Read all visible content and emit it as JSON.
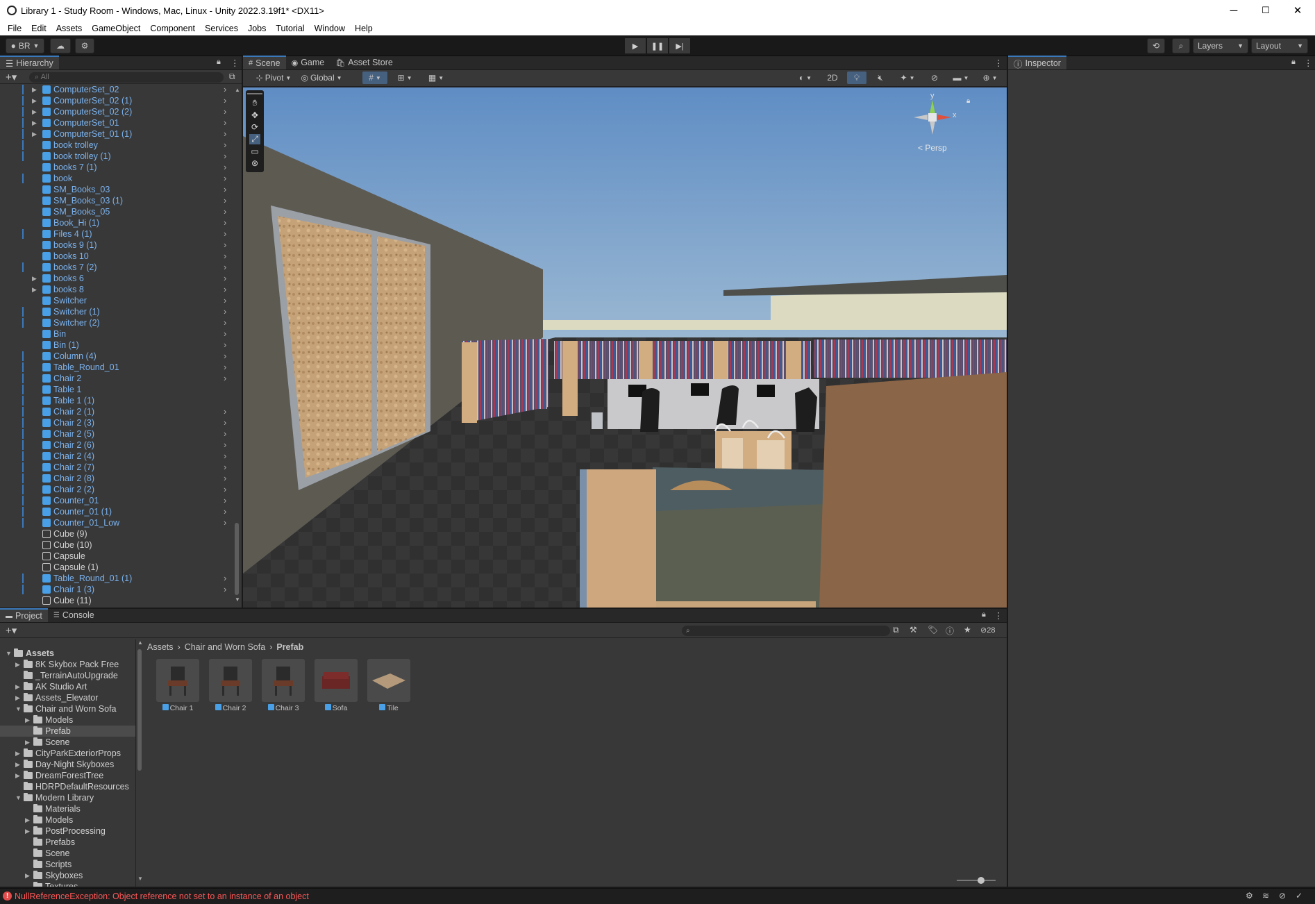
{
  "window": {
    "title": "Library 1 - Study Room - Windows, Mac, Linux - Unity 2022.3.19f1* <DX11>",
    "minimize": "─",
    "maximize": "☐",
    "close": "✕"
  },
  "menu": [
    "File",
    "Edit",
    "Assets",
    "GameObject",
    "Component",
    "Services",
    "Jobs",
    "Tutorial",
    "Window",
    "Help"
  ],
  "toolbar": {
    "account": "BR",
    "layers": "Layers",
    "layout": "Layout"
  },
  "hierarchy": {
    "tab": "Hierarchy",
    "search_placeholder": "All",
    "items": [
      {
        "name": "ComputerSet_02",
        "fold": true,
        "bar": true,
        "arrow": true,
        "prefab": true
      },
      {
        "name": "ComputerSet_02 (1)",
        "fold": true,
        "bar": true,
        "arrow": true,
        "prefab": true
      },
      {
        "name": "ComputerSet_02 (2)",
        "fold": true,
        "bar": true,
        "arrow": true,
        "prefab": true
      },
      {
        "name": "ComputerSet_01",
        "fold": true,
        "bar": true,
        "arrow": true,
        "prefab": true
      },
      {
        "name": "ComputerSet_01 (1)",
        "fold": true,
        "bar": true,
        "arrow": true,
        "prefab": true
      },
      {
        "name": "book trolley",
        "fold": false,
        "bar": true,
        "arrow": true,
        "prefab": true
      },
      {
        "name": "book trolley (1)",
        "fold": false,
        "bar": true,
        "arrow": true,
        "prefab": true
      },
      {
        "name": "books 7 (1)",
        "fold": false,
        "bar": false,
        "arrow": true,
        "prefab": true
      },
      {
        "name": "book",
        "fold": false,
        "bar": true,
        "arrow": true,
        "prefab": true
      },
      {
        "name": "SM_Books_03",
        "fold": false,
        "bar": false,
        "arrow": true,
        "prefab": true
      },
      {
        "name": "SM_Books_03 (1)",
        "fold": false,
        "bar": false,
        "arrow": true,
        "prefab": true
      },
      {
        "name": "SM_Books_05",
        "fold": false,
        "bar": false,
        "arrow": true,
        "prefab": true
      },
      {
        "name": "Book_Hi (1)",
        "fold": false,
        "bar": false,
        "arrow": true,
        "prefab": true
      },
      {
        "name": "Files 4 (1)",
        "fold": false,
        "bar": true,
        "arrow": true,
        "prefab": true
      },
      {
        "name": "books 9 (1)",
        "fold": false,
        "bar": false,
        "arrow": true,
        "prefab": true
      },
      {
        "name": "books 10",
        "fold": false,
        "bar": false,
        "arrow": true,
        "prefab": true
      },
      {
        "name": "books 7 (2)",
        "fold": false,
        "bar": true,
        "arrow": true,
        "prefab": true
      },
      {
        "name": "books 6",
        "fold": true,
        "bar": false,
        "arrow": true,
        "prefab": true
      },
      {
        "name": "books 8",
        "fold": true,
        "bar": false,
        "arrow": true,
        "prefab": true
      },
      {
        "name": "Switcher",
        "fold": false,
        "bar": false,
        "arrow": true,
        "prefab": true
      },
      {
        "name": "Switcher (1)",
        "fold": false,
        "bar": true,
        "arrow": true,
        "prefab": true
      },
      {
        "name": "Switcher (2)",
        "fold": false,
        "bar": true,
        "arrow": true,
        "prefab": true
      },
      {
        "name": "Bin",
        "fold": false,
        "bar": false,
        "arrow": true,
        "prefab": true
      },
      {
        "name": "Bin (1)",
        "fold": false,
        "bar": false,
        "arrow": true,
        "prefab": true
      },
      {
        "name": "Column (4)",
        "fold": false,
        "bar": true,
        "arrow": true,
        "prefab": true
      },
      {
        "name": "Table_Round_01",
        "fold": false,
        "bar": true,
        "arrow": true,
        "prefab": true
      },
      {
        "name": "Chair 2",
        "fold": false,
        "bar": true,
        "arrow": true,
        "prefab": true
      },
      {
        "name": "Table 1",
        "fold": false,
        "bar": true,
        "arrow": false,
        "prefab": true
      },
      {
        "name": "Table 1 (1)",
        "fold": false,
        "bar": true,
        "arrow": false,
        "prefab": true
      },
      {
        "name": "Chair 2 (1)",
        "fold": false,
        "bar": true,
        "arrow": true,
        "prefab": true
      },
      {
        "name": "Chair 2 (3)",
        "fold": false,
        "bar": true,
        "arrow": true,
        "prefab": true
      },
      {
        "name": "Chair 2 (5)",
        "fold": false,
        "bar": true,
        "arrow": true,
        "prefab": true
      },
      {
        "name": "Chair 2 (6)",
        "fold": false,
        "bar": true,
        "arrow": true,
        "prefab": true
      },
      {
        "name": "Chair 2 (4)",
        "fold": false,
        "bar": true,
        "arrow": true,
        "prefab": true
      },
      {
        "name": "Chair 2 (7)",
        "fold": false,
        "bar": true,
        "arrow": true,
        "prefab": true
      },
      {
        "name": "Chair 2 (8)",
        "fold": false,
        "bar": true,
        "arrow": true,
        "prefab": true
      },
      {
        "name": "Chair 2 (2)",
        "fold": false,
        "bar": true,
        "arrow": true,
        "prefab": true
      },
      {
        "name": "Counter_01",
        "fold": false,
        "bar": true,
        "arrow": true,
        "prefab": true
      },
      {
        "name": "Counter_01 (1)",
        "fold": false,
        "bar": true,
        "arrow": true,
        "prefab": true
      },
      {
        "name": "Counter_01_Low",
        "fold": false,
        "bar": true,
        "arrow": true,
        "prefab": true
      },
      {
        "name": "Cube (9)",
        "fold": false,
        "bar": false,
        "arrow": false,
        "prefab": false
      },
      {
        "name": "Cube (10)",
        "fold": false,
        "bar": false,
        "arrow": false,
        "prefab": false
      },
      {
        "name": "Capsule",
        "fold": false,
        "bar": false,
        "arrow": false,
        "prefab": false
      },
      {
        "name": "Capsule (1)",
        "fold": false,
        "bar": false,
        "arrow": false,
        "prefab": false
      },
      {
        "name": "Table_Round_01 (1)",
        "fold": false,
        "bar": true,
        "arrow": true,
        "prefab": true
      },
      {
        "name": "Chair 1 (3)",
        "fold": false,
        "bar": true,
        "arrow": true,
        "prefab": true
      },
      {
        "name": "Cube (11)",
        "fold": false,
        "bar": false,
        "arrow": false,
        "prefab": false
      }
    ]
  },
  "scene": {
    "tabs": [
      "Scene",
      "Game",
      "Asset Store"
    ],
    "pivot": "Pivot",
    "global": "Global",
    "mode_2d": "2D",
    "persp": "< Persp",
    "gizmo_y": "y",
    "gizmo_x": "x"
  },
  "inspector": {
    "tab": "Inspector"
  },
  "project": {
    "tabs": [
      "Project",
      "Console"
    ],
    "hidden_count": "28",
    "breadcrumb": [
      "Assets",
      "Chair and Worn Sofa",
      "Prefab"
    ],
    "tree": [
      {
        "name": "Assets",
        "depth": 0,
        "expanded": true,
        "bold": true
      },
      {
        "name": "8K Skybox Pack Free",
        "depth": 1,
        "expanded": false
      },
      {
        "name": "_TerrainAutoUpgrade",
        "depth": 1,
        "expanded": null
      },
      {
        "name": "AK Studio Art",
        "depth": 1,
        "expanded": false
      },
      {
        "name": "Assets_Elevator",
        "depth": 1,
        "expanded": false
      },
      {
        "name": "Chair and Worn Sofa",
        "depth": 1,
        "expanded": true
      },
      {
        "name": "Models",
        "depth": 2,
        "expanded": false
      },
      {
        "name": "Prefab",
        "depth": 2,
        "expanded": null,
        "selected": true
      },
      {
        "name": "Scene",
        "depth": 2,
        "expanded": false
      },
      {
        "name": "CityParkExteriorProps",
        "depth": 1,
        "expanded": false
      },
      {
        "name": "Day-Night Skyboxes",
        "depth": 1,
        "expanded": false
      },
      {
        "name": "DreamForestTree",
        "depth": 1,
        "expanded": false
      },
      {
        "name": "HDRPDefaultResources",
        "depth": 1,
        "expanded": null
      },
      {
        "name": "Modern Library",
        "depth": 1,
        "expanded": true
      },
      {
        "name": "Materials",
        "depth": 2,
        "expanded": null
      },
      {
        "name": "Models",
        "depth": 2,
        "expanded": false
      },
      {
        "name": "PostProcessing",
        "depth": 2,
        "expanded": false
      },
      {
        "name": "Prefabs",
        "depth": 2,
        "expanded": null
      },
      {
        "name": "Scene",
        "depth": 2,
        "expanded": null
      },
      {
        "name": "Scripts",
        "depth": 2,
        "expanded": null
      },
      {
        "name": "Skyboxes",
        "depth": 2,
        "expanded": false
      },
      {
        "name": "Textures",
        "depth": 2,
        "expanded": null
      }
    ],
    "assets": [
      {
        "name": "Chair 1",
        "icon": "chair-thumb"
      },
      {
        "name": "Chair 2",
        "icon": "chair-thumb"
      },
      {
        "name": "Chair 3",
        "icon": "chair-thumb"
      },
      {
        "name": "Sofa",
        "icon": "sofa-thumb"
      },
      {
        "name": "Tile",
        "icon": "tile-thumb"
      }
    ]
  },
  "status": {
    "error": "NullReferenceException: Object reference not set to an instance of an object"
  },
  "colors": {
    "accent": "#3a79bb",
    "prefab_blue": "#7bb3ef",
    "error": "#ff5757"
  }
}
